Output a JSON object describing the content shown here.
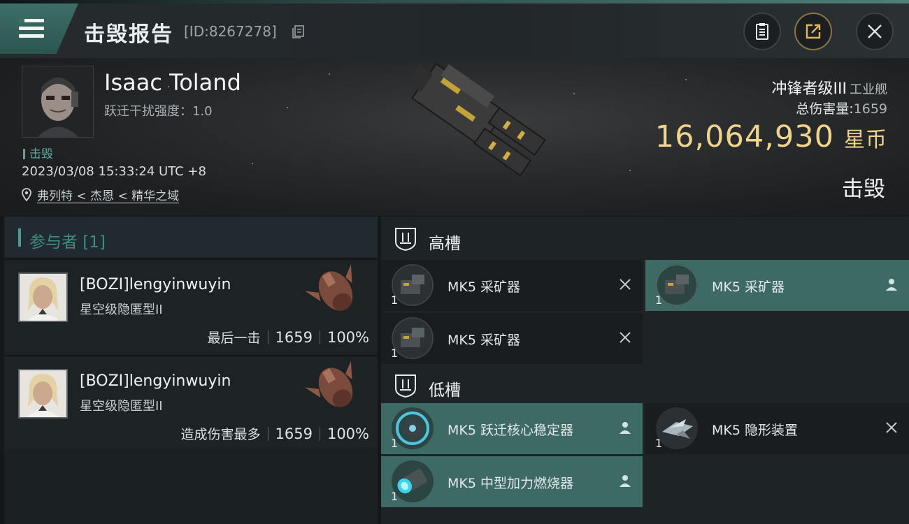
{
  "header": {
    "title": "击毁报告",
    "report_id": "[ID:8267278]",
    "buttons": [
      "clipboard",
      "share",
      "close"
    ]
  },
  "victim": {
    "pilot_name": "Isaac Toland",
    "warp_disruption": "跃迁干扰强度：1.0",
    "kill_tag": "击毁",
    "timestamp": "2023/03/08 15:33:24 UTC +8",
    "location": "弗列特 < 杰恩 < 精华之域",
    "ship_class": "冲锋者级III",
    "ship_type": "工业舰",
    "total_damage_label": "总伤害量:",
    "total_damage_value": "1659",
    "isk_value": "16,064,930",
    "isk_unit": "星币",
    "status": "击毁"
  },
  "participants": {
    "title": "参与者 [1]",
    "items": [
      {
        "name": "[BOZI]lengyinwuyin",
        "ship": "星空级隐匿型II",
        "role": "最后一击",
        "damage": "1659",
        "percent": "100%"
      },
      {
        "name": "[BOZI]lengyinwuyin",
        "ship": "星空级隐匿型II",
        "role": "造成伤害最多",
        "damage": "1659",
        "percent": "100%"
      }
    ]
  },
  "fittings": {
    "high_slots": {
      "title": "高槽",
      "modules": [
        {
          "name": "MK5 采矿器",
          "qty": "1",
          "state": "destroyed"
        },
        {
          "name": "MK5 采矿器",
          "qty": "1",
          "state": "dropped"
        },
        {
          "name": "MK5 采矿器",
          "qty": "1",
          "state": "destroyed"
        }
      ]
    },
    "low_slots": {
      "title": "低槽",
      "modules": [
        {
          "name": "MK5 跃迁核心稳定器",
          "qty": "1",
          "state": "dropped"
        },
        {
          "name": "MK5 隐形装置",
          "qty": "1",
          "state": "destroyed"
        },
        {
          "name": "MK5 中型加力燃烧器",
          "qty": "1",
          "state": "dropped"
        }
      ]
    }
  },
  "colors": {
    "accent_teal": "#3e6a66",
    "isk_gold": "#f1d48c"
  }
}
